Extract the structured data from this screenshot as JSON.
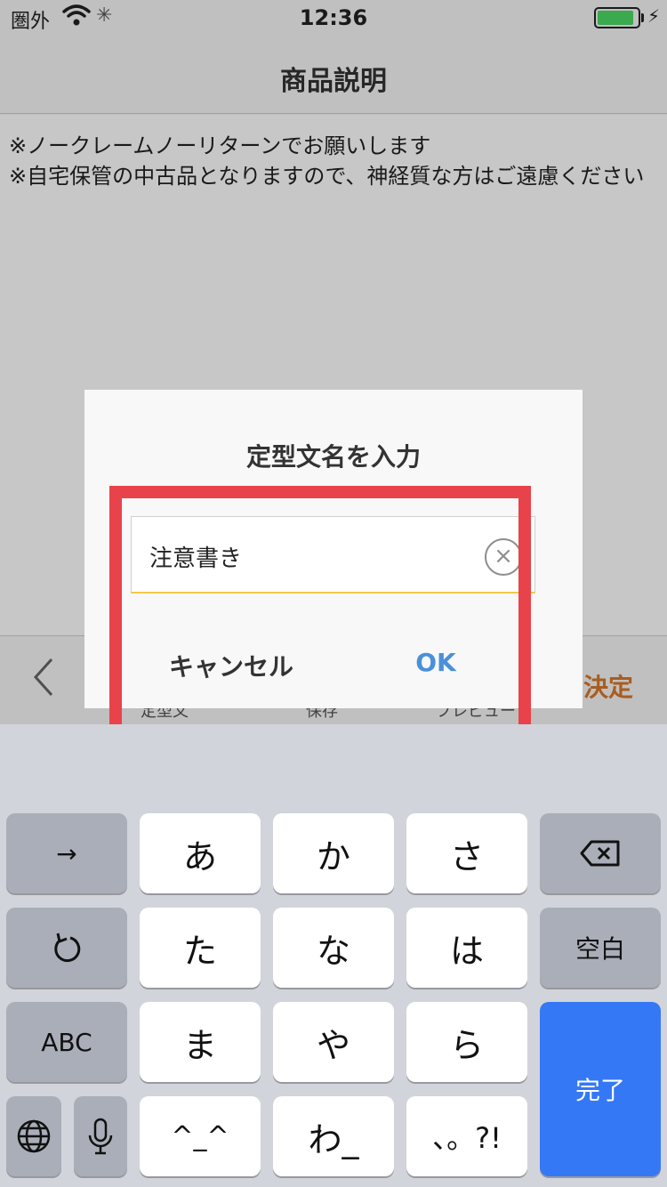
{
  "statusbar": {
    "carrier": "圏外",
    "time": "12:36",
    "battery_level": 0.9
  },
  "nav": {
    "title": "商品説明"
  },
  "content": {
    "line1": "※ノークレームノーリターンでお願いします",
    "line2": "※自宅保管の中古品となりますので、神経質な方はご遠慮ください"
  },
  "toolbar": {
    "back_icon": "chevron-left-icon",
    "label1": "定型文",
    "label2": "保存",
    "label3": "プレビュー",
    "decide": "決定"
  },
  "dialog": {
    "title": "定型文名を入力",
    "input_value": "注意書き",
    "clear_icon": "clear-circle-icon",
    "cancel": "キャンセル",
    "ok": "OK"
  },
  "colors": {
    "accent_orange": "#d8782a",
    "ok_blue": "#4a90d9",
    "highlight_red": "#e8434a",
    "done_blue": "#3478f6"
  },
  "keyboard": {
    "arrow": "→",
    "a": "あ",
    "ka": "か",
    "sa": "さ",
    "backspace_icon": "backspace-icon",
    "undo_icon": "undo-icon",
    "ta": "た",
    "na": "な",
    "ha": "は",
    "space": "空白",
    "abc": "ABC",
    "ma": "ま",
    "ya": "や",
    "ra": "ら",
    "done": "完了",
    "globe_icon": "globe-icon",
    "mic_icon": "microphone-icon",
    "emoticon": "^_^",
    "wa": "わ_",
    "punct": "、。?!"
  }
}
